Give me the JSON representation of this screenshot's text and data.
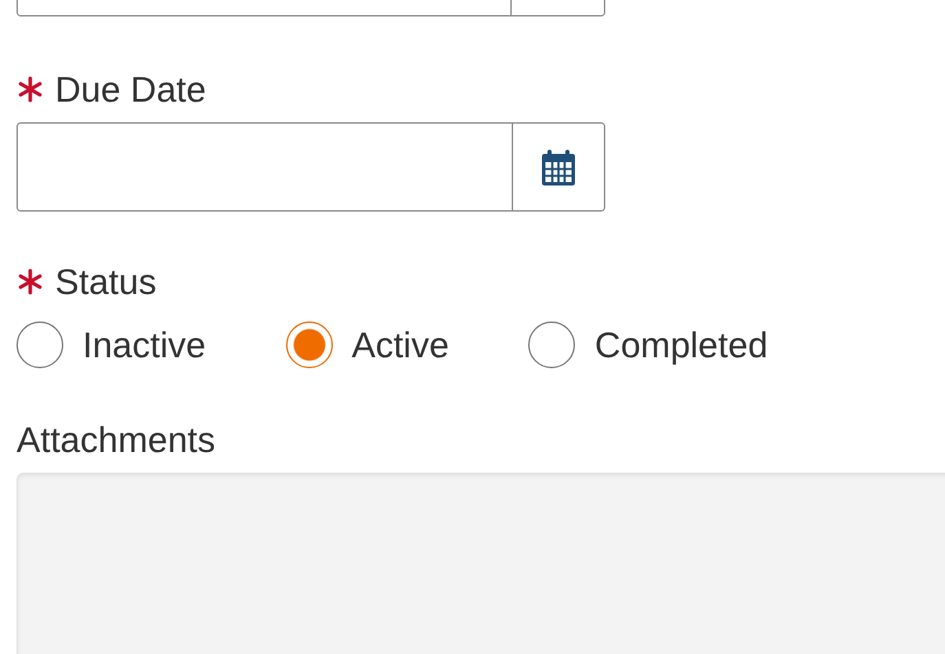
{
  "fields": [
    {
      "kind": "cut-field"
    },
    {
      "kind": "date",
      "label": "Due Date",
      "required": true
    },
    {
      "kind": "radio",
      "label": "Status",
      "required": true,
      "options": [
        {
          "label": "Inactive",
          "selected": false
        },
        {
          "label": "Active",
          "selected": true
        },
        {
          "label": "Completed",
          "selected": false
        }
      ]
    },
    {
      "kind": "dropzone",
      "label": "Attachments",
      "required": false
    }
  ]
}
